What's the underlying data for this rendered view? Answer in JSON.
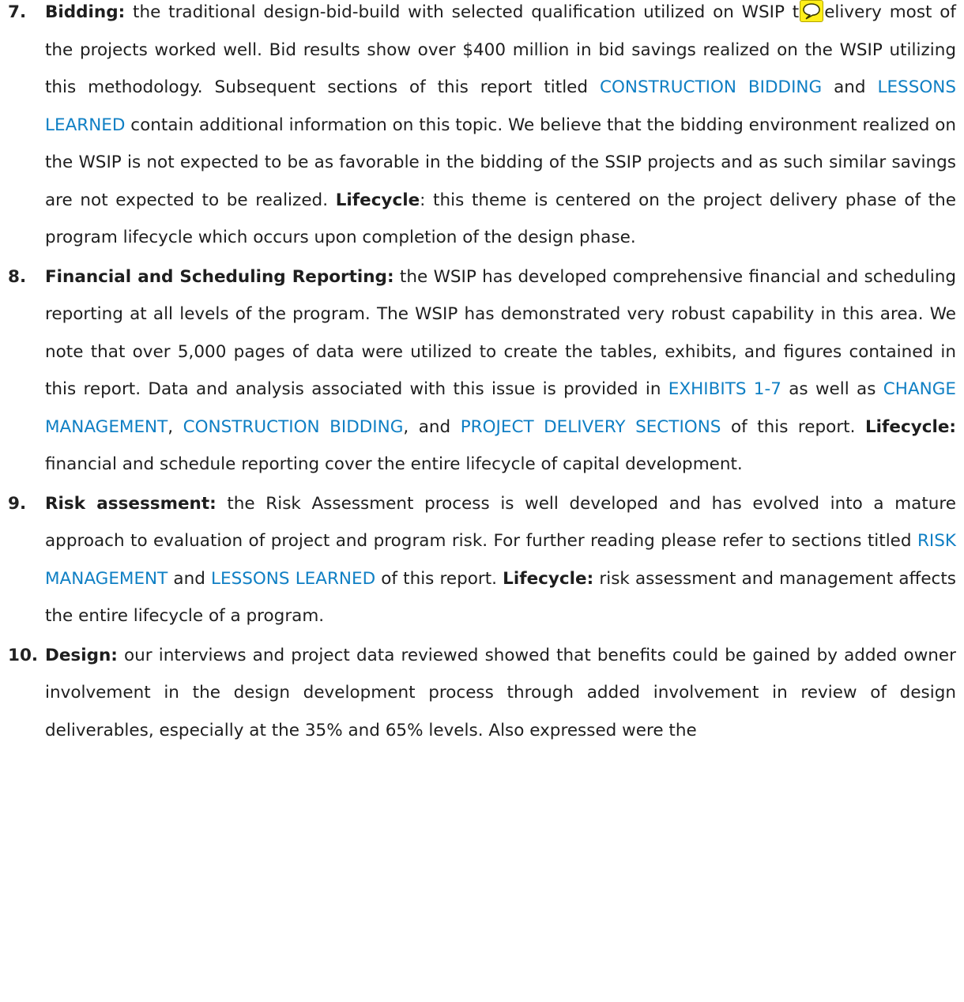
{
  "items": [
    {
      "number": "7.",
      "title": "Bidding:",
      "t1": " the traditional design-bid-build with selected qualification utilized on WSIP t",
      "comment_icon": "speech-bubble-comment-icon",
      "t1b": "elivery most of the projects worked well.  Bid results show over $400 million in bid savings realized on the WSIP utilizing this methodology.  Subsequent sections of this report titled ",
      "link1": "CONSTRUCTION BIDDING",
      "t2": " and ",
      "link2": "LESSONS LEARNED",
      "t3": " contain additional information on this topic.  We believe that the bidding environment realized on the WSIP is not expected to be as favorable in the bidding of the SSIP projects and as such similar savings are not expected to be realized.  ",
      "lifecycle_label": "Lifecycle",
      "t4": ":  this theme is centered on the project delivery phase of the program lifecycle which occurs upon completion of the design phase."
    },
    {
      "number": "8.",
      "title": "Financial and Scheduling Reporting:",
      "t1": "  the WSIP has developed comprehensive financial and scheduling reporting at all levels of the program.  The WSIP has demonstrated very robust capability in this area.  We note that over 5,000 pages of data were utilized to create the tables, exhibits, and figures contained in this report.  Data and analysis associated with this issue is provided in ",
      "link1": "EXHIBITS 1-7",
      "t2": " as well as ",
      "link2": "CHANGE MANAGEMENT",
      "t3": ", ",
      "link3": "CONSTRUCTION BIDDING",
      "t4": ", and ",
      "link4": "PROJECT DELIVERY SECTIONS",
      "t5": " of this report.  ",
      "lifecycle_label": "Lifecycle:",
      "t6": "  financial and schedule reporting cover the entire lifecycle of capital development."
    },
    {
      "number": "9.",
      "title": "Risk assessment:",
      "t1": "  the Risk Assessment process is well developed and has evolved into a mature approach to evaluation of project and program risk.  For further reading please refer to sections titled ",
      "link1": "RISK MANAGEMENT",
      "t2": " and ",
      "link2": "LESSONS LEARNED",
      "t3": " of this report.  ",
      "lifecycle_label": "Lifecycle:",
      "t4": "  risk assessment and management affects the entire lifecycle of a program."
    },
    {
      "number": "10.",
      "title": "Design:",
      "t1": "  our interviews and project data reviewed showed that benefits could be gained by added owner involvement in the design development process through added involvement in review of design deliverables, especially at the 35% and 65% levels.  Also expressed were the"
    }
  ]
}
